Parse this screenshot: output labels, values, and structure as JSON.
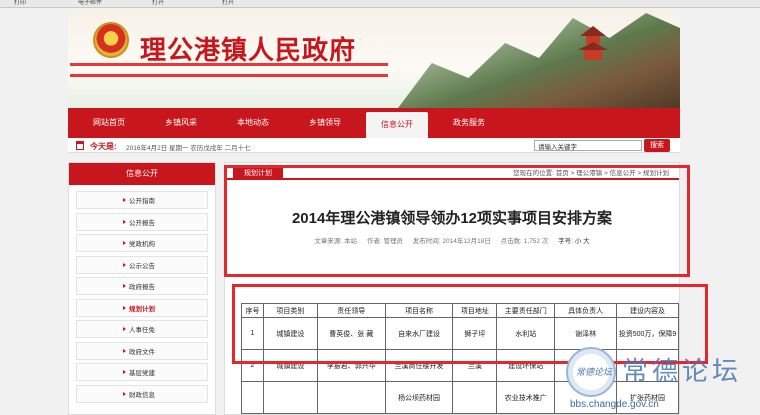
{
  "browser": {
    "items": [
      "打印",
      "电子邮件",
      "打开",
      "打开"
    ]
  },
  "header": {
    "site_title": "理公港镇人民政府"
  },
  "nav": {
    "items": [
      {
        "label": "网站首页",
        "active": false
      },
      {
        "label": "乡镇风采",
        "active": false
      },
      {
        "label": "本地动态",
        "active": false
      },
      {
        "label": "乡镇领导",
        "active": false
      },
      {
        "label": "信息公开",
        "active": true
      },
      {
        "label": "政务服务",
        "active": false
      }
    ]
  },
  "datebar": {
    "today_label": "今天是:",
    "date_text": "2016年4月2日 星期一 农历戊戌年 二月十七",
    "search_placeholder": "请输入关键字",
    "search_button": "搜索"
  },
  "sidebar": {
    "title": "信息公开",
    "items": [
      {
        "label": "公开指南",
        "active": false
      },
      {
        "label": "公开报告",
        "active": false
      },
      {
        "label": "党政机构",
        "active": false
      },
      {
        "label": "公示公告",
        "active": false
      },
      {
        "label": "政府报告",
        "active": false
      },
      {
        "label": "规划计划",
        "active": true
      },
      {
        "label": "人事任免",
        "active": false
      },
      {
        "label": "政府文件",
        "active": false
      },
      {
        "label": "基层党建",
        "active": false
      },
      {
        "label": "财政信息",
        "active": false
      }
    ]
  },
  "content": {
    "tab_label": "规划计划",
    "breadcrumb": "您现在的位置: 首页 > 理公港镇 > 信息公开 > 规划计划",
    "title": "2014年理公港镇领导领办12项实事项目安排方案",
    "meta": {
      "source": "文章来源: 本站",
      "author": "作者: 管理员",
      "date": "发布时间: 2014年12月18日",
      "hits": "点击数: 1,752 次",
      "fontsize": "字号: 小 大"
    }
  },
  "table": {
    "headers": [
      "序号",
      "项目类别",
      "责任领导",
      "项目名称",
      "项目地址",
      "主要责任部门",
      "具体负责人",
      "建设内容及"
    ],
    "rows": [
      [
        "1",
        "城镇建设",
        "曹英俊、张 藏",
        "自来水厂建设",
        "狮子坪",
        "水利站",
        "谢泽林",
        "投资500万，保障9"
      ],
      [
        "2",
        "城镇建设",
        "李振君、郭兴华",
        "兰溪商住楼开发",
        "兰溪",
        "建设环保站",
        "",
        ""
      ],
      [
        "",
        "",
        "",
        "杨公坝药材园",
        "",
        "农业技术推广",
        "",
        "扩张药材园"
      ]
    ]
  },
  "watermark": {
    "name": "常德论坛",
    "url": "bbs.changde.gov.cn",
    "logo_text": "常德论坛"
  }
}
